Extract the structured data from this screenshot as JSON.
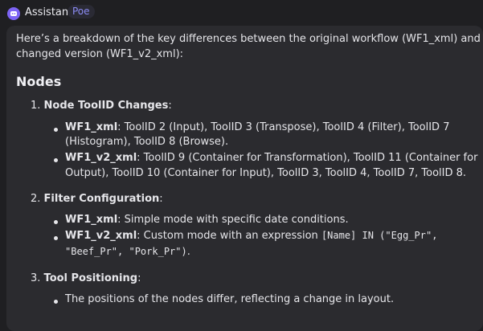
{
  "header": {
    "name": "Assistant",
    "badge": "Poe"
  },
  "message": {
    "intro_line1": "Here’s a breakdown of the key differences between the original workflow (WF1_xml) and the",
    "intro_line2": "changed version (WF1_v2_xml):",
    "heading": "Nodes",
    "items": [
      {
        "num": "1.",
        "title": "Node ToolID Changes",
        "colon": ":",
        "bullets": [
          {
            "label": "WF1_xml",
            "line1": ": ToolID 2 (Input), ToolID 3 (Transpose), ToolID 4 (Filter), ToolID 7",
            "line2": "(Histogram), ToolID 8 (Browse)."
          },
          {
            "label": "WF1_v2_xml",
            "line1": ": ToolID 9 (Container for Transformation), ToolID 11 (Container for",
            "line2": "Output), ToolID 10 (Container for Input), ToolID 3, ToolID 4, ToolID 7, ToolID 8."
          }
        ]
      },
      {
        "num": "2.",
        "title": "Filter Configuration",
        "colon": ":",
        "bullets": [
          {
            "label": "WF1_xml",
            "line1": ": Simple mode with specific date conditions."
          },
          {
            "label": "WF1_v2_xml",
            "line1": ": Custom mode with an expression ",
            "code1": "[Name] IN (\"Egg_Pr\",",
            "code2": "\"Beef_Pr\", \"Pork_Pr\")",
            "end2": "."
          }
        ]
      },
      {
        "num": "3.",
        "title": "Tool Positioning",
        "colon": ":",
        "bullets": [
          {
            "line1": "The positions of the nodes differ, reflecting a change in layout."
          }
        ]
      }
    ]
  },
  "colors": {
    "background": "#1f1f22",
    "bubble": "#2b2b2f",
    "accent": "#7d64f5",
    "badge_text": "#8c8cf5"
  },
  "icons": {
    "avatar": "bot-avatar-icon"
  }
}
